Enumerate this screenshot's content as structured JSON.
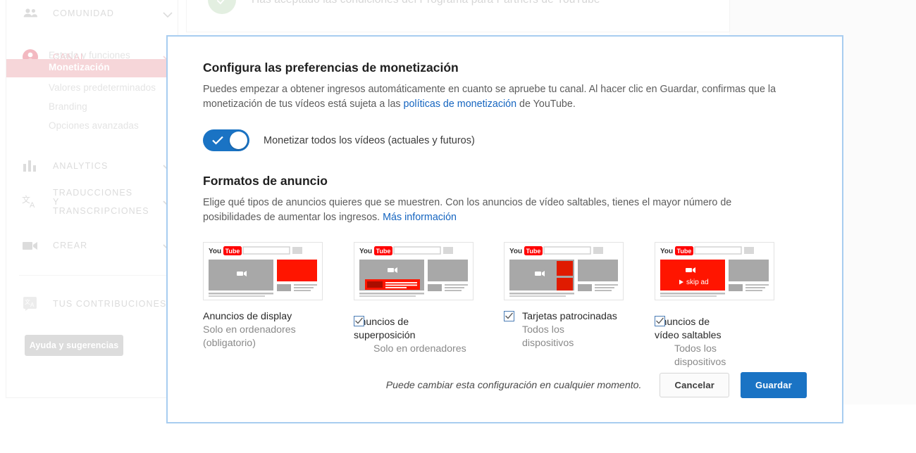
{
  "banner": {
    "icon": "check-circle-icon",
    "text": "Has aceptado las condiciones del Programa para Partners de YouTube"
  },
  "sidebar": {
    "sections": [
      {
        "label": "COMUNIDAD",
        "icon": "people-icon",
        "chevron": "chevron-down-icon"
      },
      {
        "label": "CANAL",
        "icon": "account-circle-icon",
        "chevron": "chevron-down-icon"
      },
      {
        "label": "ANALYTICS",
        "icon": "bar-chart-icon",
        "chevron": "chevron-down-icon"
      },
      {
        "label": "TRADUCCIONES Y TRANSCRIPCIONES",
        "icon": "translate-icon",
        "chevron": "chevron-down-icon"
      },
      {
        "label": "CREAR",
        "icon": "video-camera-icon",
        "chevron": "chevron-down-icon"
      },
      {
        "label": "TUS CONTRIBUCIONES",
        "icon": "translate-box-icon"
      }
    ],
    "channel_items": [
      "Estado y funciones",
      "Monetización",
      "Valores predeterminados",
      "Branding",
      "Opciones avanzadas"
    ],
    "active_item": "Monetización",
    "help_button": "Ayuda y sugerencias"
  },
  "modal": {
    "title": "Configura las preferencias de monetización",
    "description_part1": "Puedes empezar a obtener ingresos automáticamente en cuanto se apruebe tu canal. Al hacer clic en Guardar, confirmas que la monetización de tus vídeos está sujeta a las ",
    "description_link": "políticas de monetización",
    "description_part2": " de YouTube.",
    "toggle": {
      "label": "Monetizar todos los vídeos (actuales y futuros)",
      "checked": "true"
    },
    "formats_title": "Formatos de anuncio",
    "formats_desc_part1": "Elige qué tipos de anuncios quieres que se muestren. Con los anuncios de vídeo saltables, tienes el mayor número de posibilidades de aumentar los ingresos. ",
    "formats_desc_link": "Más información",
    "formats": [
      {
        "name": "Anuncios de display",
        "sub_line1": "Solo en ordenadores",
        "sub_line2": "(obligatorio)",
        "has_checkbox": "false",
        "thumb": "display-ad-thumbnail",
        "skip_label": ""
      },
      {
        "name": "Anuncios de superposición",
        "sub_line1": "Solo en ordenadores",
        "sub_line2": "",
        "has_checkbox": "true",
        "checked": "true",
        "thumb": "overlay-ad-thumbnail",
        "skip_label": ""
      },
      {
        "name": "Tarjetas patrocinadas",
        "sub_line1": "Todos los",
        "sub_line2": "dispositivos",
        "has_checkbox": "true",
        "checked": "true",
        "thumb": "sponsored-cards-thumbnail",
        "skip_label": ""
      },
      {
        "name": "Anuncios de vídeo saltables",
        "sub_line1": "Todos los",
        "sub_line2": "dispositivos",
        "has_checkbox": "true",
        "checked": "true",
        "thumb": "skippable-video-ad-thumbnail",
        "skip_label": "skip ad"
      }
    ],
    "footer_note": "Puede cambiar esta configuración en cualquier momento.",
    "cancel_label": "Cancelar",
    "save_label": "Guardar"
  },
  "colors": {
    "accent_blue": "#1a73c4",
    "link_blue": "#1565c0",
    "modal_border": "#a8cdf0",
    "active_nav_bg": "#f6d6d9",
    "youtube_red": "#ff0000"
  },
  "brand": {
    "you": "You",
    "tube": "Tube"
  }
}
